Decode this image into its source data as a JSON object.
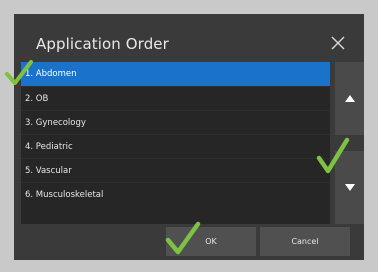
{
  "dialog": {
    "title": "Application Order",
    "close_icon": "close-icon"
  },
  "list": {
    "items": [
      {
        "label": "1. Abdomen",
        "selected": true
      },
      {
        "label": "2. OB",
        "selected": false
      },
      {
        "label": "3. Gynecology",
        "selected": false
      },
      {
        "label": "4. Pediatric",
        "selected": false
      },
      {
        "label": "5. Vascular",
        "selected": false
      },
      {
        "label": "6. Musculoskeletal",
        "selected": false
      }
    ]
  },
  "controls": {
    "move_up_icon": "triangle-up-icon",
    "move_down_icon": "triangle-down-icon"
  },
  "buttons": {
    "ok": "OK",
    "cancel": "Cancel"
  },
  "annotations": {
    "check_icon": "checkmark-icon",
    "check_color": "#7dc242"
  },
  "colors": {
    "selection": "#1a73c8",
    "dialog_bg": "#3a3a3a",
    "list_bg": "#262626"
  }
}
